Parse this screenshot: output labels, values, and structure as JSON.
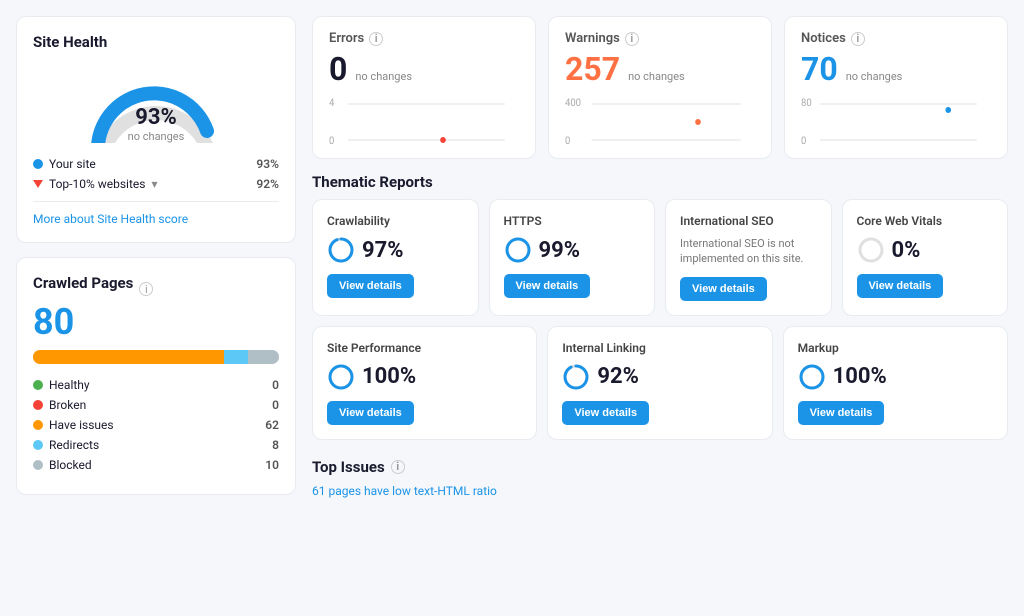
{
  "site_health": {
    "title": "Site Health",
    "percent": "93%",
    "sub": "no changes",
    "your_site_label": "Your site",
    "your_site_value": "93%",
    "top10_label": "Top-10% websites",
    "top10_value": "92%",
    "more_link": "More about Site Health score"
  },
  "crawled_pages": {
    "title": "Crawled Pages",
    "count": "80",
    "healthy_label": "Healthy",
    "healthy_count": "0",
    "broken_label": "Broken",
    "broken_count": "0",
    "issues_label": "Have issues",
    "issues_count": "62",
    "redirects_label": "Redirects",
    "redirects_count": "8",
    "blocked_label": "Blocked",
    "blocked_count": "10"
  },
  "errors": {
    "title": "Errors",
    "value": "0",
    "change": "no changes",
    "max": "4",
    "zero": "0"
  },
  "warnings": {
    "title": "Warnings",
    "value": "257",
    "change": "no changes",
    "max": "400",
    "zero": "0"
  },
  "notices": {
    "title": "Notices",
    "value": "70",
    "change": "no changes",
    "max": "80",
    "zero": "0"
  },
  "thematic_reports": {
    "title": "Thematic Reports",
    "items": [
      {
        "name": "Crawlability",
        "percent": "97%",
        "has_progress": true,
        "progress": 97,
        "has_btn": true,
        "btn_label": "View details",
        "color": "#1b94e8"
      },
      {
        "name": "HTTPS",
        "percent": "99%",
        "has_progress": true,
        "progress": 99,
        "has_btn": true,
        "btn_label": "View details",
        "color": "#1b94e8"
      },
      {
        "name": "International SEO",
        "percent": "",
        "has_progress": false,
        "has_btn": true,
        "btn_label": "View details",
        "color": "#1b94e8",
        "na_text": "International SEO is not implemented on this site."
      },
      {
        "name": "Core Web Vitals",
        "percent": "0%",
        "has_progress": true,
        "progress": 0,
        "has_btn": true,
        "btn_label": "View details",
        "color": "#ccc"
      },
      {
        "name": "Site Performance",
        "percent": "100%",
        "has_progress": true,
        "progress": 100,
        "has_btn": true,
        "btn_label": "View details",
        "color": "#1b94e8"
      },
      {
        "name": "Internal Linking",
        "percent": "92%",
        "has_progress": true,
        "progress": 92,
        "has_btn": true,
        "btn_label": "View details",
        "color": "#1b94e8"
      },
      {
        "name": "Markup",
        "percent": "100%",
        "has_progress": true,
        "progress": 100,
        "has_btn": true,
        "btn_label": "View details",
        "color": "#1b94e8"
      }
    ]
  },
  "top_issues": {
    "title": "Top Issues",
    "items": [
      {
        "text": "61 pages have low text-HTML ratio",
        "link": true
      }
    ]
  }
}
